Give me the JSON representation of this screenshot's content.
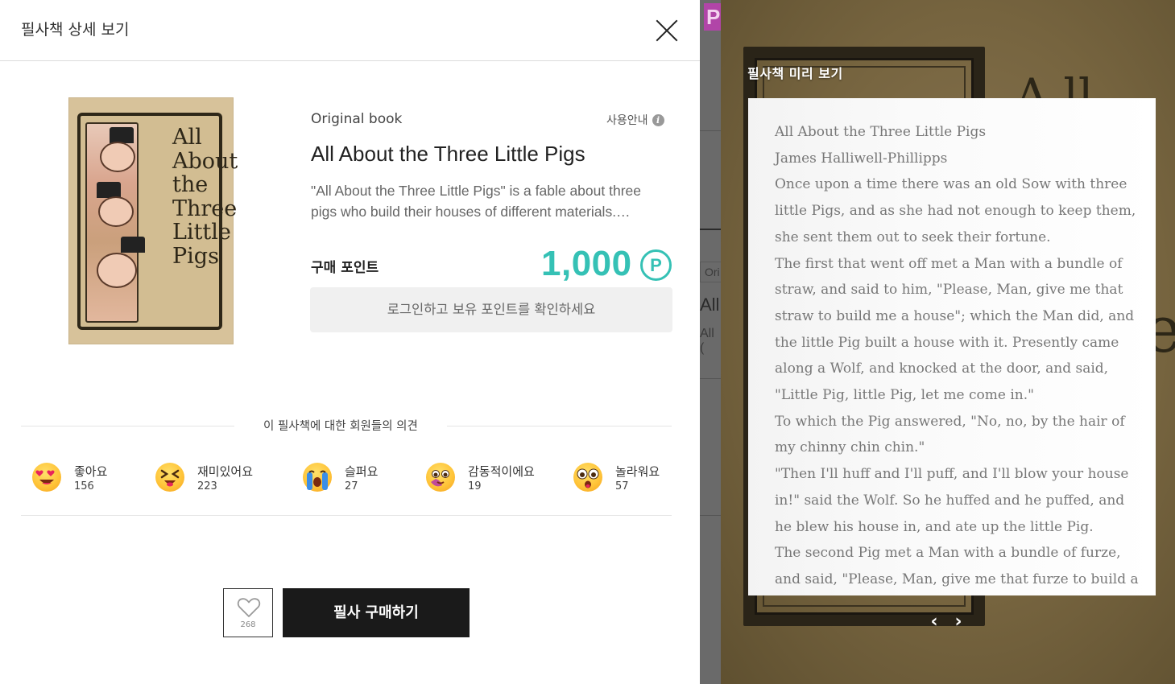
{
  "modal": {
    "title": "필사책 상세 보기",
    "original_label": "Original book",
    "guide_label": "사용안내",
    "book_title": "All About the Three Little Pigs",
    "book_description": "\"All About the Three Little Pigs\" is a fable about three pigs who build their houses of different materials.…",
    "cover_lines": [
      "All",
      "About",
      "the",
      "Three",
      "Little",
      "Pigs"
    ],
    "points_label": "구매 포인트",
    "points_value": "1,000",
    "points_symbol": "P",
    "login_prompt": "로그인하고 보유 포인트를 확인하세요",
    "opinion_title": "이 필사책에 대한 회원들의 의견",
    "reactions": [
      {
        "label": "좋아요",
        "count": "156",
        "icon": "heart-eyes-emoji"
      },
      {
        "label": "재미있어요",
        "count": "223",
        "icon": "laughing-squint-emoji"
      },
      {
        "label": "슬퍼요",
        "count": "27",
        "icon": "crying-emoji"
      },
      {
        "label": "감동적이에요",
        "count": "19",
        "icon": "touched-emoji"
      },
      {
        "label": "놀라워요",
        "count": "57",
        "icon": "surprised-emoji"
      }
    ],
    "like_count": "268",
    "buy_label": "필사 구매하기"
  },
  "preview": {
    "title": "필사책 미리 보기",
    "lines": [
      "All About the Three Little Pigs",
      "James Halliwell-Phillipps",
      "Once upon a time there was an old Sow with three",
      "little Pigs, and as she had not enough to keep them,",
      "she sent them out to seek their fortune.",
      "The first that went off met a Man with a bundle of",
      "straw, and said to him, \"Please, Man, give me that",
      "straw to build me a house\"; which the Man did, and",
      "the little Pig built a house with it. Presently came",
      "along a Wolf, and knocked at the door, and said,",
      "\"Little Pig, little Pig, let me come in.\"",
      "To which the Pig answered, \"No, no, by the hair of",
      "my chinny chin chin.\"",
      "\"Then I'll huff and I'll puff, and I'll blow your house",
      "in!\" said the Wolf. So he huffed and he puffed, and",
      "he blew his house in, and ate up the little Pig.",
      "The second Pig met a Man with a bundle of furze,",
      "and said, \"Please, Man, give me that furze to build a"
    ],
    "prev_symbol": "‹",
    "next_symbol": "›"
  },
  "background": {
    "badge": "P",
    "tag": "Ori",
    "text1": "All",
    "text2": "All ("
  },
  "colors": {
    "accent": "#35c1b5",
    "buy_button": "#1a1a1a",
    "emoji_yellow": "#ffc53a"
  }
}
